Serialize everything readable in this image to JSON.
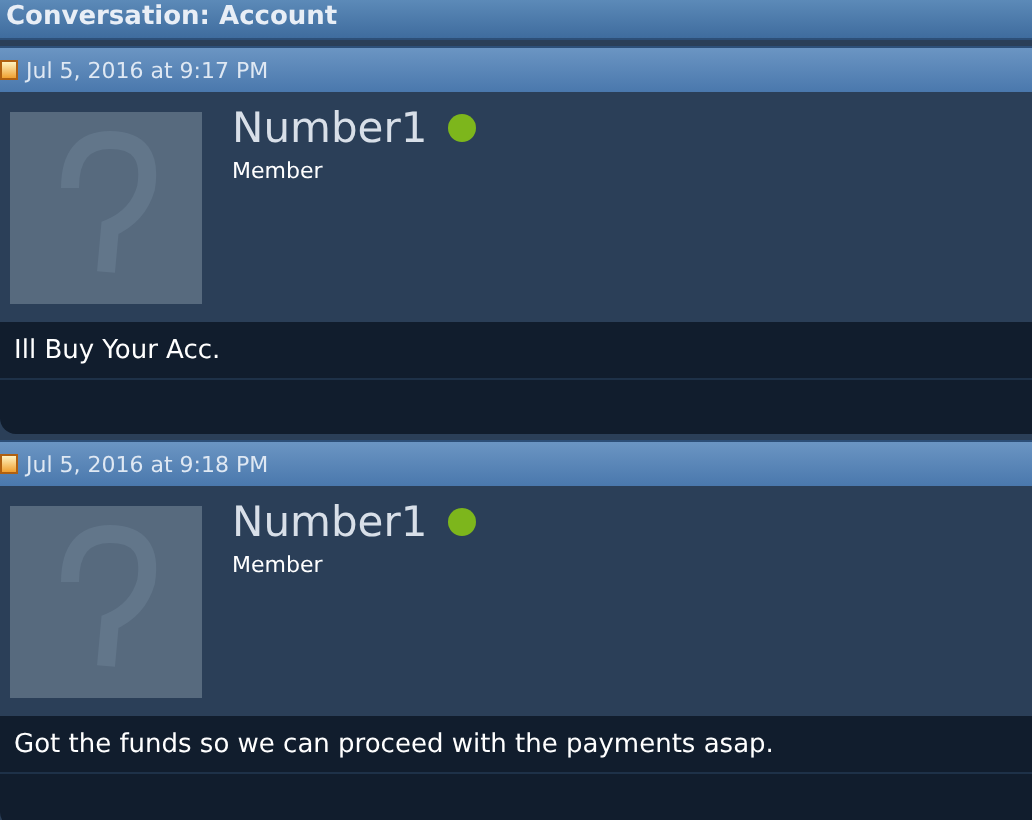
{
  "title": "Conversation: Account",
  "messages": [
    {
      "date": "Jul 5, 2016 at 9:17 PM",
      "author": "Number1",
      "online": true,
      "role": "Member",
      "text": "Ill Buy Your Acc."
    },
    {
      "date": "Jul 5, 2016 at 9:18 PM",
      "author": "Number1",
      "online": true,
      "role": "Member",
      "text": "Got the funds so we can proceed with the payments asap."
    }
  ]
}
